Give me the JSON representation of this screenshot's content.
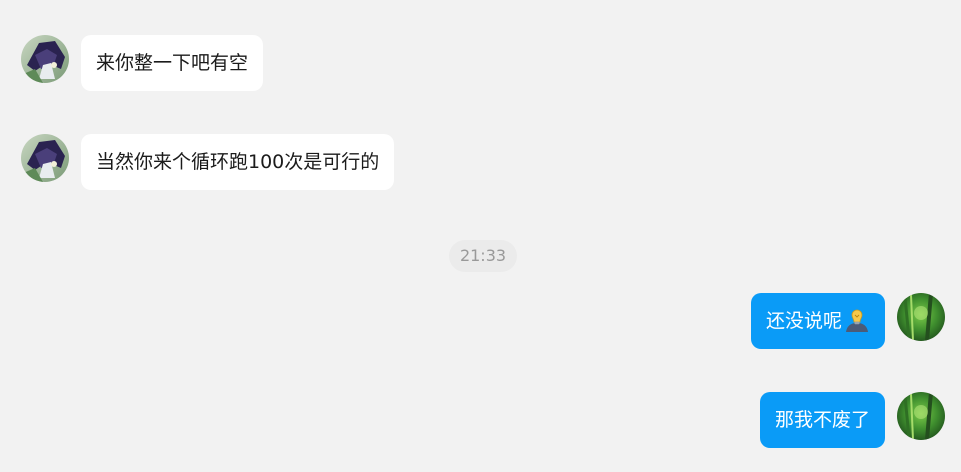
{
  "chat": {
    "messages": [
      {
        "sender": "other",
        "text": "来你整一下吧有空"
      },
      {
        "sender": "other",
        "text": "当然你来个循环跑100次是可行的"
      },
      {
        "sender": "self",
        "text": "还没说呢",
        "emoji": "thinking-light-bulb-emoji"
      },
      {
        "sender": "self",
        "text": "那我不废了"
      }
    ],
    "timestamp": "21:33"
  },
  "avatars": {
    "other": "anime-character-avatar",
    "self": "green-nature-avatar"
  },
  "colors": {
    "background": "#f2f2f2",
    "incoming_bubble": "#ffffff",
    "outgoing_bubble": "#0a9bf7",
    "timestamp_text": "#999999"
  }
}
